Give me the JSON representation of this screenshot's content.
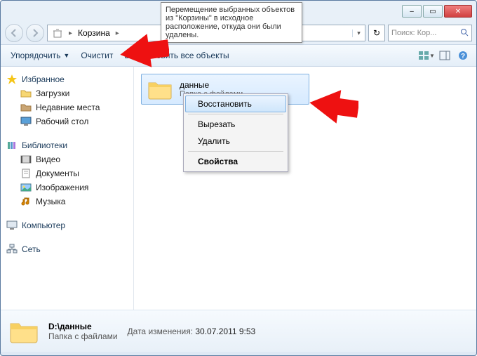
{
  "window": {
    "min": "–",
    "max": "▭",
    "close": "✕"
  },
  "nav": {
    "path_root_icon": "🗑",
    "path": "Корзина",
    "search_placeholder": "Поиск: Кор...",
    "refresh": "↻"
  },
  "tooltip": "Перемещение выбранных объектов из \"Корзины\" в исходное расположение, откуда они были удалены.",
  "toolbar": {
    "organize": "Упорядочить",
    "empty": "Очистит",
    "restore_all": "Восстановить все объекты"
  },
  "sidebar": {
    "favorites": {
      "label": "Избранное",
      "items": [
        "Загрузки",
        "Недавние места",
        "Рабочий стол"
      ]
    },
    "libraries": {
      "label": "Библиотеки",
      "items": [
        "Видео",
        "Документы",
        "Изображения",
        "Музыка"
      ]
    },
    "computer": {
      "label": "Компьютер"
    },
    "network": {
      "label": "Сеть"
    }
  },
  "content": {
    "item": {
      "name": "данные",
      "sub": "Папка с файлами"
    }
  },
  "context_menu": {
    "restore": "Восстановить",
    "cut": "Вырезать",
    "delete": "Удалить",
    "properties": "Свойства"
  },
  "details": {
    "path": "D:\\данные",
    "type": "Папка с файлами",
    "date_label": "Дата изменения:",
    "date_value": "30.07.2011 9:53"
  }
}
